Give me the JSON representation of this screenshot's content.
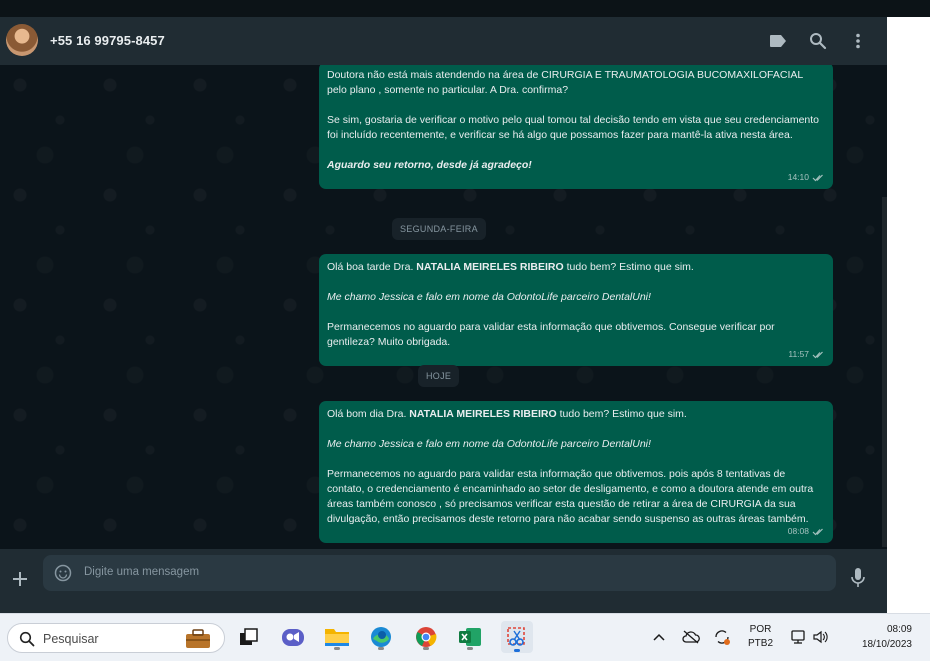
{
  "contact": {
    "name": "+55 16 99795-8457"
  },
  "messages": [
    {
      "lines": [
        "Doutora não está mais atendendo na área de  CIRURGIA E TRAUMATOLOGIA BUCOMAXILOFACIAL pelo plano , somente no particular. A Dra. confirma?",
        "Se sim, gostaria de verificar o motivo pelo qual tomou tal decisão tendo em vista que seu credenciamento foi incluído recentemente, e verificar se há algo que possamos fazer para mantê-la ativa nesta área.",
        "Aguardo seu retorno, desde já agradeço!"
      ],
      "time": "14:10"
    },
    {
      "greeting_pre": "Olá boa tarde Dra. ",
      "greeting_name": "NATALIA MEIRELES RIBEIRO",
      "greeting_post": " tudo bem? Estimo que sim.",
      "intro": "Me chamo Jessica e falo em nome da OdontoLife parceiro DentalUni!",
      "body": "Permanecemos no aguardo para validar esta informação que obtivemos. Consegue verificar por gentileza?  Muito obrigada.",
      "time": "11:57"
    },
    {
      "greeting_pre": "Olá bom dia Dra. ",
      "greeting_name": "NATALIA MEIRELES RIBEIRO",
      "greeting_post": " tudo bem? Estimo que sim.",
      "intro": "Me chamo Jessica e falo em nome da OdontoLife parceiro DentalUni!",
      "body": "Permanecemos no aguardo para validar esta informação que obtivemos. pois após 8 tentativas de contato, o credenciamento é encaminhado ao setor de desligamento, e como a doutora atende em outra áreas também conosco , só precisamos verificar esta questão de retirar a área de CIRURGIA da sua divulgação, então precisamos deste retorno para não acabar sendo suspenso as outras áreas também.",
      "time": "08:08"
    }
  ],
  "date_separators": [
    "SEGUNDA-FEIRA",
    "HOJE"
  ],
  "composer": {
    "placeholder": "Digite uma mensagem"
  },
  "taskbar": {
    "search_placeholder": "Pesquisar",
    "language": "POR",
    "layout": "PTB2",
    "time": "08:09",
    "date": "18/10/2023"
  },
  "colors": {
    "bubble_out": "#005c4b",
    "header_bg": "#202c33",
    "chat_bg": "#0b141a",
    "text_primary": "#e9edef",
    "text_secondary": "#8696a0"
  },
  "icons": [
    "label-icon",
    "search-icon",
    "menu-dots-icon",
    "plus-icon",
    "emoji-icon",
    "mic-icon",
    "double-check-icon"
  ]
}
